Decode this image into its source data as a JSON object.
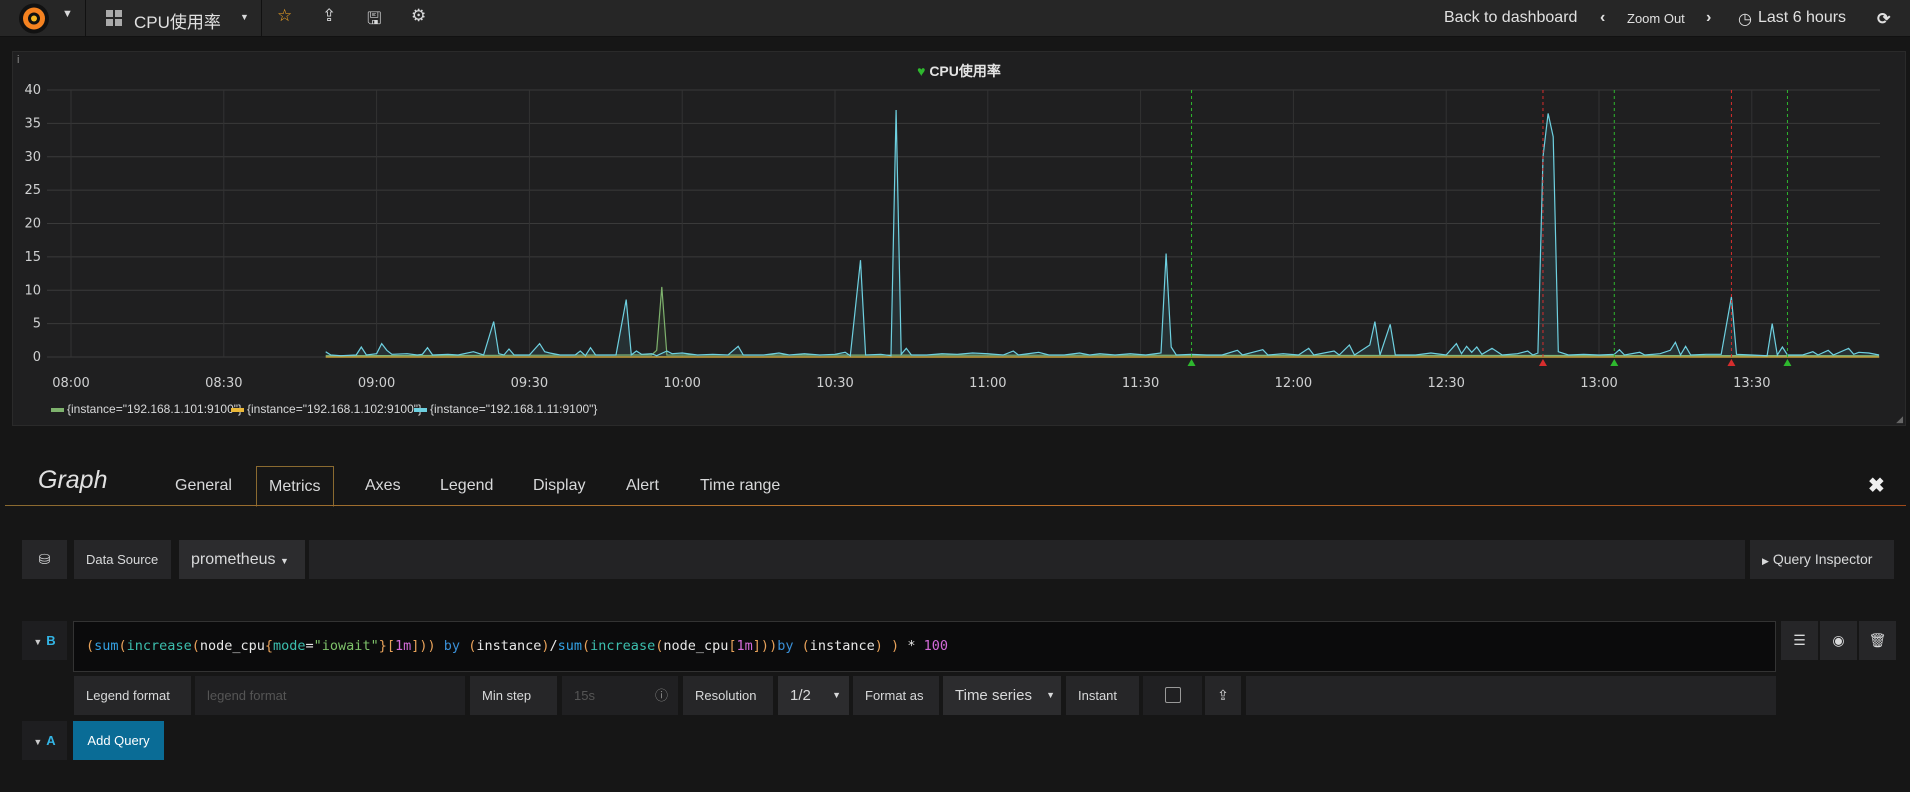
{
  "navbar": {
    "dashboard_title": "CPU使用率",
    "back_to_dashboard": "Back to dashboard",
    "zoom_out": "Zoom Out",
    "time_range": "Last 6 hours",
    "icons": [
      "grafana-logo",
      "caret-down-icon",
      "dashboard-grid-icon",
      "star-icon",
      "share-icon",
      "save-icon",
      "gear-icon",
      "chevron-left-icon",
      "chevron-right-icon",
      "clock-icon",
      "refresh-icon"
    ]
  },
  "panel": {
    "title": "CPU使用率",
    "info_icon": "i",
    "status_icon": "heart-icon"
  },
  "chart_data": {
    "type": "line",
    "title": "CPU使用率",
    "ylim": [
      0,
      40
    ],
    "yticks": [
      "0",
      "5",
      "10",
      "15",
      "20",
      "25",
      "30",
      "35",
      "40"
    ],
    "xlim": [
      "07:55",
      "13:57"
    ],
    "xticks": [
      "08:00",
      "08:30",
      "09:00",
      "09:30",
      "10:00",
      "10:30",
      "11:00",
      "11:30",
      "12:00",
      "12:30",
      "13:00",
      "13:30"
    ],
    "grid": true,
    "legend_position": "bottom",
    "series": [
      {
        "name": "{instance=\"192.168.1.101:9100\"}",
        "color": "#7eb26d",
        "points": [
          [
            "08:50",
            0.2
          ],
          [
            "09:54",
            0.3
          ],
          [
            "09:55",
            1.0
          ],
          [
            "09:56",
            10.5
          ],
          [
            "09:57",
            0.3
          ],
          [
            "13:55",
            0.2
          ]
        ]
      },
      {
        "name": "{instance=\"192.168.1.102:9100\"}",
        "color": "#eab839",
        "points": [
          [
            "08:50",
            0
          ],
          [
            "13:55",
            0
          ]
        ]
      },
      {
        "name": "{instance=\"192.168.1.11:9100\"}",
        "color": "#6ed0e0",
        "points": [
          [
            "08:50",
            0.8
          ],
          [
            "08:51",
            0.3
          ],
          [
            "08:53",
            0.2
          ],
          [
            "08:56",
            0.3
          ],
          [
            "08:57",
            1.5
          ],
          [
            "08:58",
            0.3
          ],
          [
            "09:00",
            0.5
          ],
          [
            "09:01",
            2.0
          ],
          [
            "09:02",
            1.0
          ],
          [
            "09:03",
            0.4
          ],
          [
            "09:06",
            0.5
          ],
          [
            "09:08",
            0.3
          ],
          [
            "09:09",
            0.4
          ],
          [
            "09:10",
            1.4
          ],
          [
            "09:11",
            0.3
          ],
          [
            "09:14",
            0.4
          ],
          [
            "09:16",
            0.3
          ],
          [
            "09:19",
            0.8
          ],
          [
            "09:21",
            0.3
          ],
          [
            "09:23",
            5.3
          ],
          [
            "09:24",
            0.5
          ],
          [
            "09:25",
            0.3
          ],
          [
            "09:26",
            1.2
          ],
          [
            "09:27",
            0.3
          ],
          [
            "09:30",
            0.3
          ],
          [
            "09:32",
            2.0
          ],
          [
            "09:33",
            0.8
          ],
          [
            "09:34",
            0.6
          ],
          [
            "09:36",
            0.3
          ],
          [
            "09:39",
            0.3
          ],
          [
            "09:40",
            0.9
          ],
          [
            "09:41",
            0.2
          ],
          [
            "09:42",
            1.4
          ],
          [
            "09:43",
            0.3
          ],
          [
            "09:47",
            0.3
          ],
          [
            "09:49",
            8.6
          ],
          [
            "09:50",
            0.3
          ],
          [
            "09:51",
            0.9
          ],
          [
            "09:52",
            0.4
          ],
          [
            "09:54",
            0.5
          ],
          [
            "09:55",
            0.2
          ],
          [
            "09:57",
            0.9
          ],
          [
            "09:58",
            0.5
          ],
          [
            "10:00",
            0.6
          ],
          [
            "10:03",
            0.3
          ],
          [
            "10:06",
            0.4
          ],
          [
            "10:09",
            0.3
          ],
          [
            "10:11",
            1.6
          ],
          [
            "10:12",
            0.3
          ],
          [
            "10:16",
            0.3
          ],
          [
            "10:19",
            0.6
          ],
          [
            "10:21",
            0.3
          ],
          [
            "10:24",
            0.5
          ],
          [
            "10:27",
            0.3
          ],
          [
            "10:30",
            0.4
          ],
          [
            "10:32",
            0.7
          ],
          [
            "10:33",
            0.2
          ],
          [
            "10:35",
            14.5
          ],
          [
            "10:36",
            0.3
          ],
          [
            "10:39",
            0.4
          ],
          [
            "10:41",
            0.2
          ],
          [
            "10:42",
            37
          ],
          [
            "10:43",
            0.4
          ],
          [
            "10:44",
            1.3
          ],
          [
            "10:45",
            0.3
          ],
          [
            "10:48",
            0.3
          ],
          [
            "10:51",
            0.5
          ],
          [
            "10:54",
            0.4
          ],
          [
            "10:57",
            0.6
          ],
          [
            "11:00",
            0.5
          ],
          [
            "11:03",
            0.3
          ],
          [
            "11:05",
            0.9
          ],
          [
            "11:06",
            0.3
          ],
          [
            "11:09",
            0.6
          ],
          [
            "11:10",
            0.7
          ],
          [
            "11:12",
            0.3
          ],
          [
            "11:15",
            0.3
          ],
          [
            "11:18",
            0.6
          ],
          [
            "11:20",
            0.3
          ],
          [
            "11:22",
            0.5
          ],
          [
            "11:25",
            0.3
          ],
          [
            "11:28",
            0.5
          ],
          [
            "11:31",
            0.3
          ],
          [
            "11:34",
            0.6
          ],
          [
            "11:35",
            15.5
          ],
          [
            "11:36",
            1.5
          ],
          [
            "11:37",
            0.3
          ],
          [
            "11:40",
            0.4
          ],
          [
            "11:43",
            0.3
          ],
          [
            "11:46",
            0.3
          ],
          [
            "11:49",
            1.0
          ],
          [
            "11:50",
            0.3
          ],
          [
            "11:54",
            1.1
          ],
          [
            "11:55",
            0.3
          ],
          [
            "11:58",
            0.5
          ],
          [
            "12:01",
            0.3
          ],
          [
            "12:03",
            1.3
          ],
          [
            "12:04",
            0.3
          ],
          [
            "12:08",
            0.9
          ],
          [
            "12:09",
            0.3
          ],
          [
            "12:11",
            1.8
          ],
          [
            "12:12",
            0.3
          ],
          [
            "12:15",
            1.8
          ],
          [
            "12:16",
            5.3
          ],
          [
            "12:17",
            0.3
          ],
          [
            "12:19",
            4.9
          ],
          [
            "12:20",
            0.3
          ],
          [
            "12:24",
            0.3
          ],
          [
            "12:27",
            0.6
          ],
          [
            "12:30",
            0.3
          ],
          [
            "12:32",
            2.0
          ],
          [
            "12:33",
            0.5
          ],
          [
            "12:34",
            1.6
          ],
          [
            "12:35",
            0.7
          ],
          [
            "12:36",
            1.5
          ],
          [
            "12:37",
            0.4
          ],
          [
            "12:39",
            1.3
          ],
          [
            "12:41",
            0.3
          ],
          [
            "12:44",
            0.5
          ],
          [
            "12:46",
            0.9
          ],
          [
            "12:47",
            0.3
          ],
          [
            "12:48",
            0.6
          ],
          [
            "12:49",
            30
          ],
          [
            "12:50",
            36.5
          ],
          [
            "12:51",
            33
          ],
          [
            "12:52",
            0.8
          ],
          [
            "12:54",
            0.3
          ],
          [
            "12:57",
            0.4
          ],
          [
            "13:00",
            0.3
          ],
          [
            "13:03",
            0.4
          ],
          [
            "13:04",
            1.1
          ],
          [
            "13:05",
            0.3
          ],
          [
            "13:08",
            0.7
          ],
          [
            "13:09",
            0.3
          ],
          [
            "13:12",
            0.5
          ],
          [
            "13:14",
            1.0
          ],
          [
            "13:15",
            2.2
          ],
          [
            "13:16",
            0.3
          ],
          [
            "13:17",
            1.6
          ],
          [
            "13:18",
            0.3
          ],
          [
            "13:21",
            0.4
          ],
          [
            "13:24",
            0.4
          ],
          [
            "13:26",
            9.0
          ],
          [
            "13:27",
            0.4
          ],
          [
            "13:30",
            0.3
          ],
          [
            "13:33",
            0.2
          ],
          [
            "13:34",
            5.0
          ],
          [
            "13:35",
            0.3
          ],
          [
            "13:36",
            1.5
          ],
          [
            "13:37",
            0.3
          ],
          [
            "13:40",
            0.3
          ],
          [
            "13:42",
            0.8
          ],
          [
            "13:43",
            0.3
          ],
          [
            "13:45",
            1.0
          ],
          [
            "13:46",
            0.3
          ],
          [
            "13:49",
            1.3
          ],
          [
            "13:50",
            0.4
          ],
          [
            "13:51",
            0.7
          ],
          [
            "13:53",
            0.6
          ],
          [
            "13:55",
            0.3
          ]
        ]
      }
    ],
    "annotations": [
      {
        "time": "11:40",
        "state": "ok",
        "color": "#2eb82e"
      },
      {
        "time": "12:49",
        "state": "alerting",
        "color": "#d62d2d"
      },
      {
        "time": "13:03",
        "state": "ok",
        "color": "#2eb82e"
      },
      {
        "time": "13:26",
        "state": "alerting",
        "color": "#d62d2d"
      },
      {
        "time": "13:37",
        "state": "ok",
        "color": "#2eb82e"
      }
    ]
  },
  "editor": {
    "title": "Graph",
    "tabs": [
      "General",
      "Metrics",
      "Axes",
      "Legend",
      "Display",
      "Alert",
      "Time range"
    ],
    "active_tab": "Metrics",
    "data_source_label": "Data Source",
    "data_source_value": "prometheus",
    "query_inspector": "Query Inspector",
    "queries": [
      {
        "ref": "B",
        "expr": "(sum(increase(node_cpu{mode=\"iowait\"}[1m])) by (instance)/sum(increase(node_cpu[1m]))by (instance) ) * 100",
        "tokens": [
          [
            "(",
            "p"
          ],
          [
            "sum",
            "f"
          ],
          [
            "(",
            "p"
          ],
          [
            "increase",
            "g"
          ],
          [
            "(",
            "p"
          ],
          [
            "node_cpu",
            "w"
          ],
          [
            "{",
            "p"
          ],
          [
            "mode",
            "g"
          ],
          [
            "=",
            "w"
          ],
          [
            "\"iowait\"",
            "s"
          ],
          [
            "}",
            "p"
          ],
          [
            "[",
            "p"
          ],
          [
            "1m",
            "m"
          ],
          [
            "]",
            "p"
          ],
          [
            ")",
            "p"
          ],
          [
            ")",
            "p"
          ],
          [
            " by ",
            "k"
          ],
          [
            "(",
            "p"
          ],
          [
            "instance",
            "w"
          ],
          [
            ")",
            "p"
          ],
          [
            "/",
            "w"
          ],
          [
            "sum",
            "f"
          ],
          [
            "(",
            "p"
          ],
          [
            "increase",
            "g"
          ],
          [
            "(",
            "p"
          ],
          [
            "node_cpu",
            "w"
          ],
          [
            "[",
            "p"
          ],
          [
            "1m",
            "m"
          ],
          [
            "]",
            "p"
          ],
          [
            ")",
            "p"
          ],
          [
            ")",
            "p"
          ],
          [
            "by ",
            "k"
          ],
          [
            "(",
            "p"
          ],
          [
            "instance",
            "w"
          ],
          [
            ")",
            "p"
          ],
          [
            " ",
            "w"
          ],
          [
            ")",
            "p"
          ],
          [
            " * ",
            "w"
          ],
          [
            "100",
            "m"
          ]
        ],
        "legend_format_label": "Legend format",
        "legend_format_placeholder": "legend format",
        "min_step_label": "Min step",
        "min_step_placeholder": "15s",
        "resolution_label": "Resolution",
        "resolution_value": "1/2",
        "format_as_label": "Format as",
        "format_as_value": "Time series",
        "instant_label": "Instant",
        "instant_checked": false
      }
    ],
    "next_ref": "A",
    "add_query": "Add Query"
  }
}
